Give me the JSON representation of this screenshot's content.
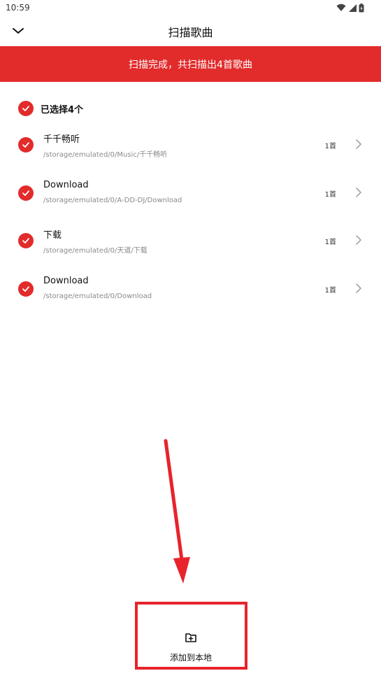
{
  "status_bar": {
    "time": "10:59"
  },
  "header": {
    "title": "扫描歌曲"
  },
  "banner": {
    "text": "扫描完成，共扫描出4首歌曲"
  },
  "selection": {
    "label": "已选择4个"
  },
  "folders": [
    {
      "name": "千千畅听",
      "path": "/storage/emulated/0/Music/千千畅听",
      "count": "1首"
    },
    {
      "name": "Download",
      "path": "/storage/emulated/0/A-DD-DJ/Download",
      "count": "1首"
    },
    {
      "name": "下载",
      "path": "/storage/emulated/0/天道/下载",
      "count": "1首"
    },
    {
      "name": "Download",
      "path": "/storage/emulated/0/Download",
      "count": "1首"
    }
  ],
  "bottom_action": {
    "label": "添加到本地"
  },
  "icons": {
    "back": "chevron-down-icon",
    "check": "check-icon",
    "row_chevron": "chevron-right-icon",
    "add": "folder-add-icon",
    "wifi": "wifi-icon",
    "signal": "signal-icon",
    "battery": "battery-icon"
  },
  "colors": {
    "accent": "#e22b2b",
    "annotation": "#e8232c"
  }
}
